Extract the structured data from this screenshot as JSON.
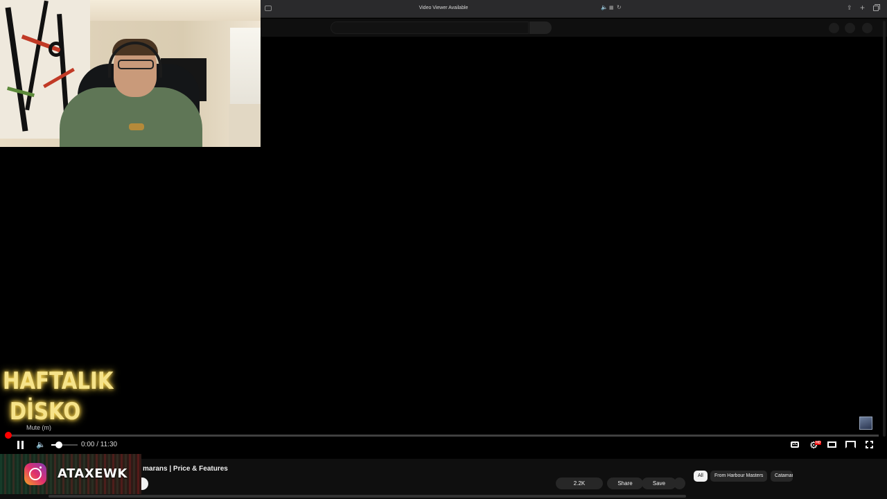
{
  "browser": {
    "title": "Video Viewer Available"
  },
  "overlay": {
    "brand_line1": "HAFTALIK",
    "brand_line2": "DİSKO",
    "mute_tooltip": "Mute (m)",
    "instagram_handle": "ATAXEWK"
  },
  "player": {
    "time": "0:00 / 11:30",
    "progress": 0,
    "volume": 0.3,
    "cc_label": "CC",
    "hd_badge": "HD",
    "accent_color": "#ff0000"
  },
  "video": {
    "title_partial": "marans | Price & Features",
    "likes": "2.2K",
    "share_label": "Share",
    "save_label": "Save"
  },
  "chips": [
    {
      "label": "All",
      "active": true
    },
    {
      "label": "From Harbour Masters",
      "active": false
    },
    {
      "label": "Catamaran",
      "active": false
    }
  ]
}
